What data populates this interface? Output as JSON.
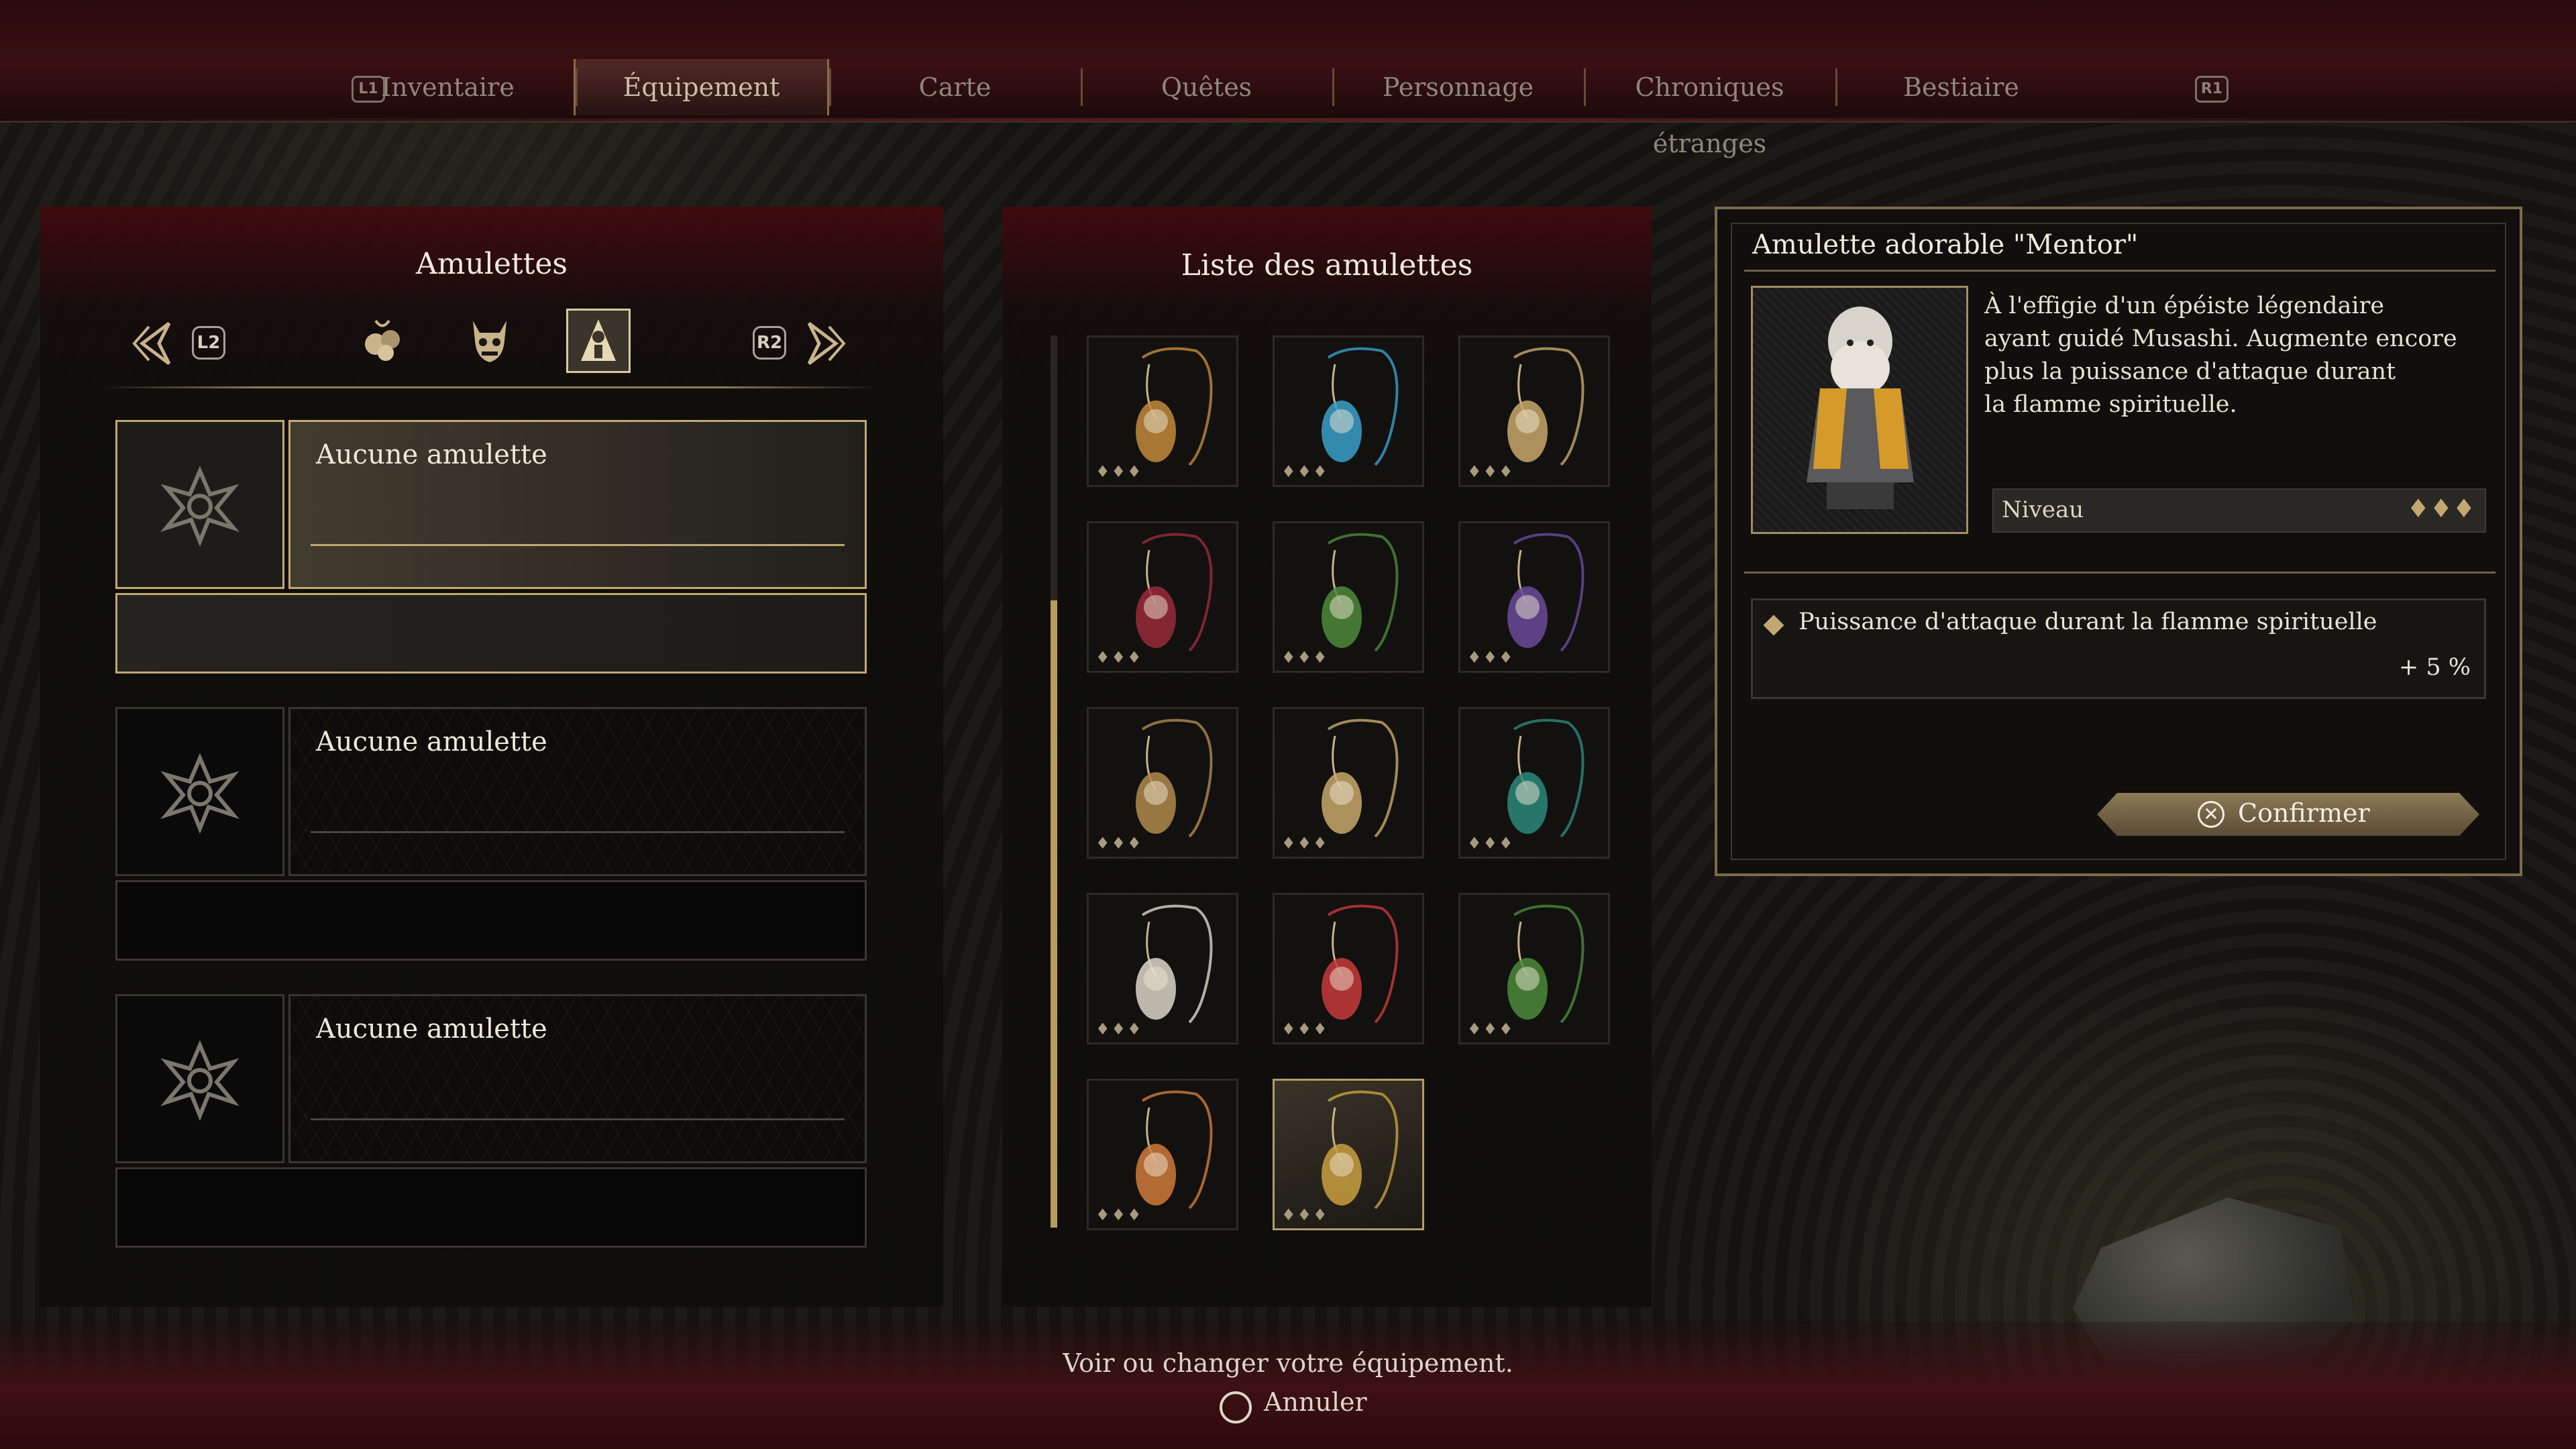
{
  "nav": {
    "left_button": "L1",
    "right_button": "R1",
    "tabs": [
      {
        "label": "Inventaire"
      },
      {
        "label": "Équipement",
        "active": true
      },
      {
        "label": "Carte"
      },
      {
        "label": "Quêtes"
      },
      {
        "label": "Personnage"
      },
      {
        "label": "Chroniques étranges"
      },
      {
        "label": "Bestiaire"
      }
    ]
  },
  "left_panel": {
    "title": "Amulettes",
    "prev_button": "L2",
    "next_button": "R2",
    "categories": [
      "charm-cluster-icon",
      "demon-mask-icon",
      "hooded-figure-icon"
    ],
    "active_category": "hooded-figure-icon",
    "slots": [
      {
        "name": "Aucune amulette",
        "selected": true
      },
      {
        "name": "Aucune amulette",
        "selected": false
      },
      {
        "name": "Aucune amulette",
        "selected": false
      }
    ]
  },
  "list_panel": {
    "title": "Liste des amulettes",
    "items": [
      {
        "icon": "pouch-charm-icon",
        "color": "#c28a3a",
        "level": "♦♦♦"
      },
      {
        "icon": "blue-feather-charm-icon",
        "color": "#3aa0c8",
        "level": "♦♦♦"
      },
      {
        "icon": "teal-orb-charm-icon",
        "color": "#c9a86a",
        "level": "♦♦♦"
      },
      {
        "icon": "red-fur-charm-icon",
        "color": "#9a2a3a",
        "level": "♦♦♦"
      },
      {
        "icon": "green-fur-charm-icon",
        "color": "#4e8a3a",
        "level": "♦♦♦"
      },
      {
        "icon": "purple-fur-charm-icon",
        "color": "#6a4a9a",
        "level": "♦♦♦"
      },
      {
        "icon": "brush-charm-icon",
        "color": "#b08a4a",
        "level": "♦♦♦"
      },
      {
        "icon": "lantern-charm-icon",
        "color": "#c9a86a",
        "level": "♦♦♦"
      },
      {
        "icon": "spiral-charm-icon",
        "color": "#2a8a7a",
        "level": "♦♦♦"
      },
      {
        "icon": "cat-plush-charm-icon",
        "color": "#dcd6c8",
        "level": "♦♦♦"
      },
      {
        "icon": "daruma-charm-icon",
        "color": "#c83a3a",
        "level": "♦♦♦"
      },
      {
        "icon": "green-robe-charm-icon",
        "color": "#4a8a3a",
        "level": "♦♦♦"
      },
      {
        "icon": "girl-doll-charm-icon",
        "color": "#d07a3a",
        "level": "♦♦♦"
      },
      {
        "icon": "mentor-doll-charm-icon",
        "color": "#c9a040",
        "level": "♦♦♦",
        "selected": true
      }
    ]
  },
  "detail": {
    "title": "Amulette adorable \"Mentor\"",
    "description_lines": [
      "À l'effigie d'un épéiste légendaire",
      "ayant guidé Musashi. Augmente encore",
      "plus la puissance d'attaque durant",
      "la flamme spirituelle."
    ],
    "level_label": "Niveau",
    "level_pips": "♦♦♦",
    "stat_label": "Puissance d'attaque durant la flamme spirituelle",
    "stat_value": "+ 5 %",
    "confirm_label": "Confirmer",
    "confirm_button_glyph": "✕"
  },
  "footer": {
    "hint": "Voir ou changer votre équipement.",
    "cancel_label": "Annuler"
  },
  "colors": {
    "accent_gold": "#c2a870",
    "banner_red": "#3a0f13"
  }
}
